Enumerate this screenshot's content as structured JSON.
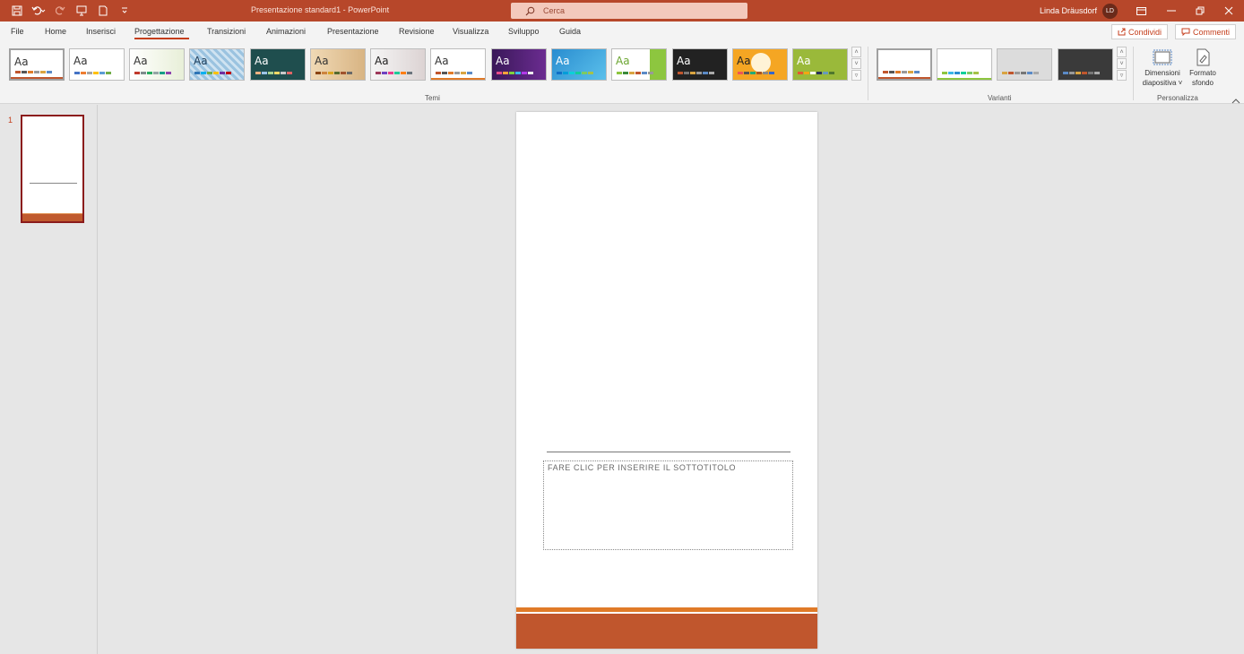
{
  "titlebar": {
    "doc_title": "Presentazione standard1  -  PowerPoint",
    "search_placeholder": "Cerca",
    "user_name": "Linda Dräusdorf",
    "avatar_initials": "LD"
  },
  "tabs": [
    "File",
    "Home",
    "Inserisci",
    "Progettazione",
    "Transizioni",
    "Animazioni",
    "Presentazione",
    "Revisione",
    "Visualizza",
    "Sviluppo",
    "Guida"
  ],
  "active_tab": "Progettazione",
  "share": {
    "condividi": "Condividi",
    "commenti": "Commenti"
  },
  "ribbon": {
    "themes_label": "Temi",
    "variants_label": "Varianti",
    "customize_label": "Personalizza",
    "slide_size_label_1": "Dimensioni",
    "slide_size_label_2": "diapositiva ˅",
    "format_bg_label_1": "Formato",
    "format_bg_label_2": "sfondo",
    "theme_thumbnail_text": "Aa"
  },
  "slides_pane": {
    "slide_number": "1"
  },
  "slide": {
    "subtitle_placeholder": "FARE CLIC PER INSERIRE IL SOTTOTITOLO"
  },
  "colors": {
    "accent": "#b7472a",
    "slide_bar": "#c0562d",
    "slide_line": "#e07a28"
  }
}
